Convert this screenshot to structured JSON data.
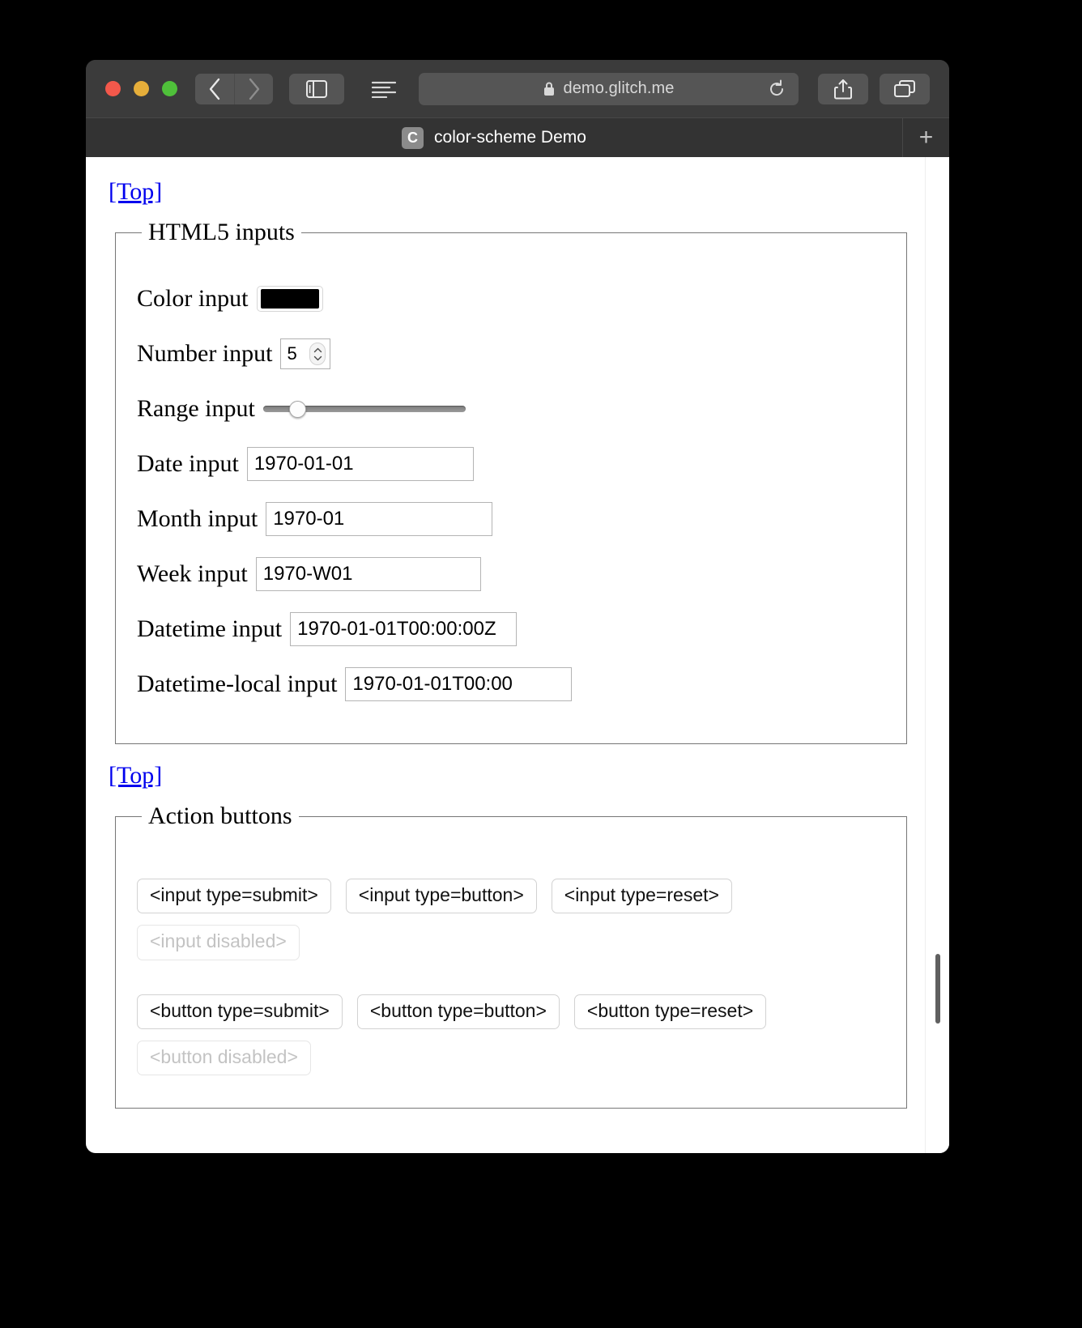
{
  "browser": {
    "url_prefix": "",
    "url_domain": "demo.glitch.me",
    "traffic_lights": [
      "close-red",
      "minimize-yellow",
      "zoom-green"
    ],
    "back_label": "‹",
    "forward_label": "›",
    "new_tab_label": "+",
    "tab": {
      "favicon_letter": "C",
      "title": "color-scheme Demo"
    },
    "icons": {
      "sidebar": "sidebar-icon",
      "reader": "reader-list-icon",
      "lock": "lock-icon",
      "reload": "reload-icon",
      "share": "share-icon",
      "tabs": "tab-overview-icon"
    }
  },
  "page": {
    "top_link_1": "[Top]",
    "top_link_2": "[Top]",
    "fieldsets": {
      "html5_inputs": {
        "legend": "HTML5 inputs",
        "rows": [
          {
            "label": "Color input",
            "type": "color",
            "value": "#000000"
          },
          {
            "label": "Number input",
            "type": "number",
            "value": "5"
          },
          {
            "label": "Range input",
            "type": "range",
            "value": "13"
          },
          {
            "label": "Date input",
            "type": "date",
            "value": "1970-01-01"
          },
          {
            "label": "Month input",
            "type": "month",
            "value": "1970-01"
          },
          {
            "label": "Week input",
            "type": "week",
            "value": "1970-W01"
          },
          {
            "label": "Datetime input",
            "type": "datetime",
            "value": "1970-01-01T00:00:00Z"
          },
          {
            "label": "Datetime-local input",
            "type": "datetime-local",
            "value": "1970-01-01T00:00"
          }
        ]
      },
      "action_buttons": {
        "legend": "Action buttons",
        "input_row": [
          {
            "label": "<input type=submit>",
            "disabled": false
          },
          {
            "label": "<input type=button>",
            "disabled": false
          },
          {
            "label": "<input type=reset>",
            "disabled": false
          }
        ],
        "input_disabled_row": [
          {
            "label": "<input disabled>",
            "disabled": true
          }
        ],
        "button_row": [
          {
            "label": "<button type=submit>",
            "disabled": false
          },
          {
            "label": "<button type=button>",
            "disabled": false
          },
          {
            "label": "<button type=reset>",
            "disabled": false
          }
        ],
        "button_disabled_row": [
          {
            "label": "<button disabled>",
            "disabled": true
          }
        ]
      }
    }
  },
  "colors": {
    "link": "#0000ee",
    "color_input_value": "#000000",
    "toolbar_bg": "#3b3b3b",
    "tabbar_bg": "#333333",
    "page_bg": "#ffffff"
  }
}
